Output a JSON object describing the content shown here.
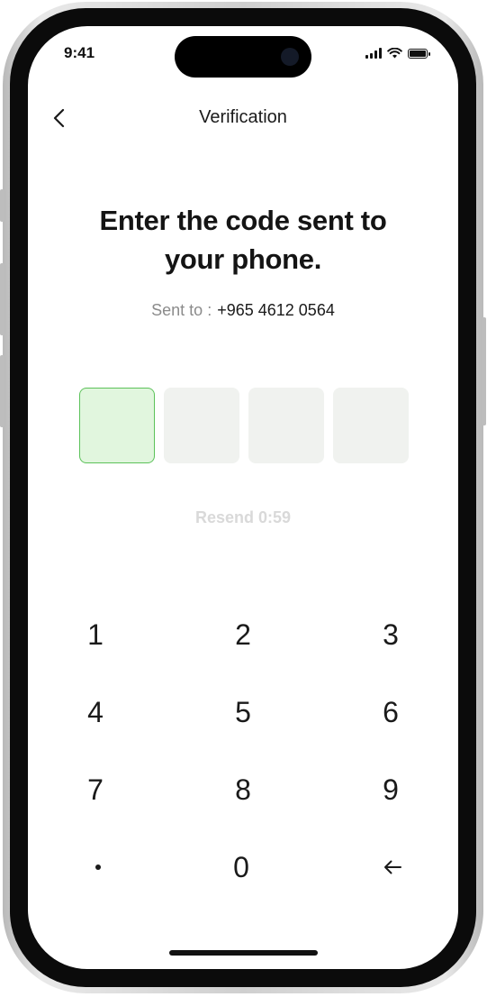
{
  "status_bar": {
    "time": "9:41"
  },
  "header": {
    "title": "Verification"
  },
  "main": {
    "headline_line1": "Enter the code sent to",
    "headline_line2": "your phone.",
    "sent_to_label": "Sent to :",
    "phone_number": "+965 4612 0564",
    "otp_length": 4,
    "resend_label": "Resend 0:59"
  },
  "keypad": {
    "keys": [
      "1",
      "2",
      "3",
      "4",
      "5",
      "6",
      "7",
      "8",
      "9",
      "",
      "0",
      ""
    ]
  },
  "colors": {
    "active_box_fill": "#e1f6de",
    "active_box_border": "#5cc25a",
    "inactive_box_fill": "#f0f2ef",
    "resend_disabled": "#d9d9d9"
  }
}
